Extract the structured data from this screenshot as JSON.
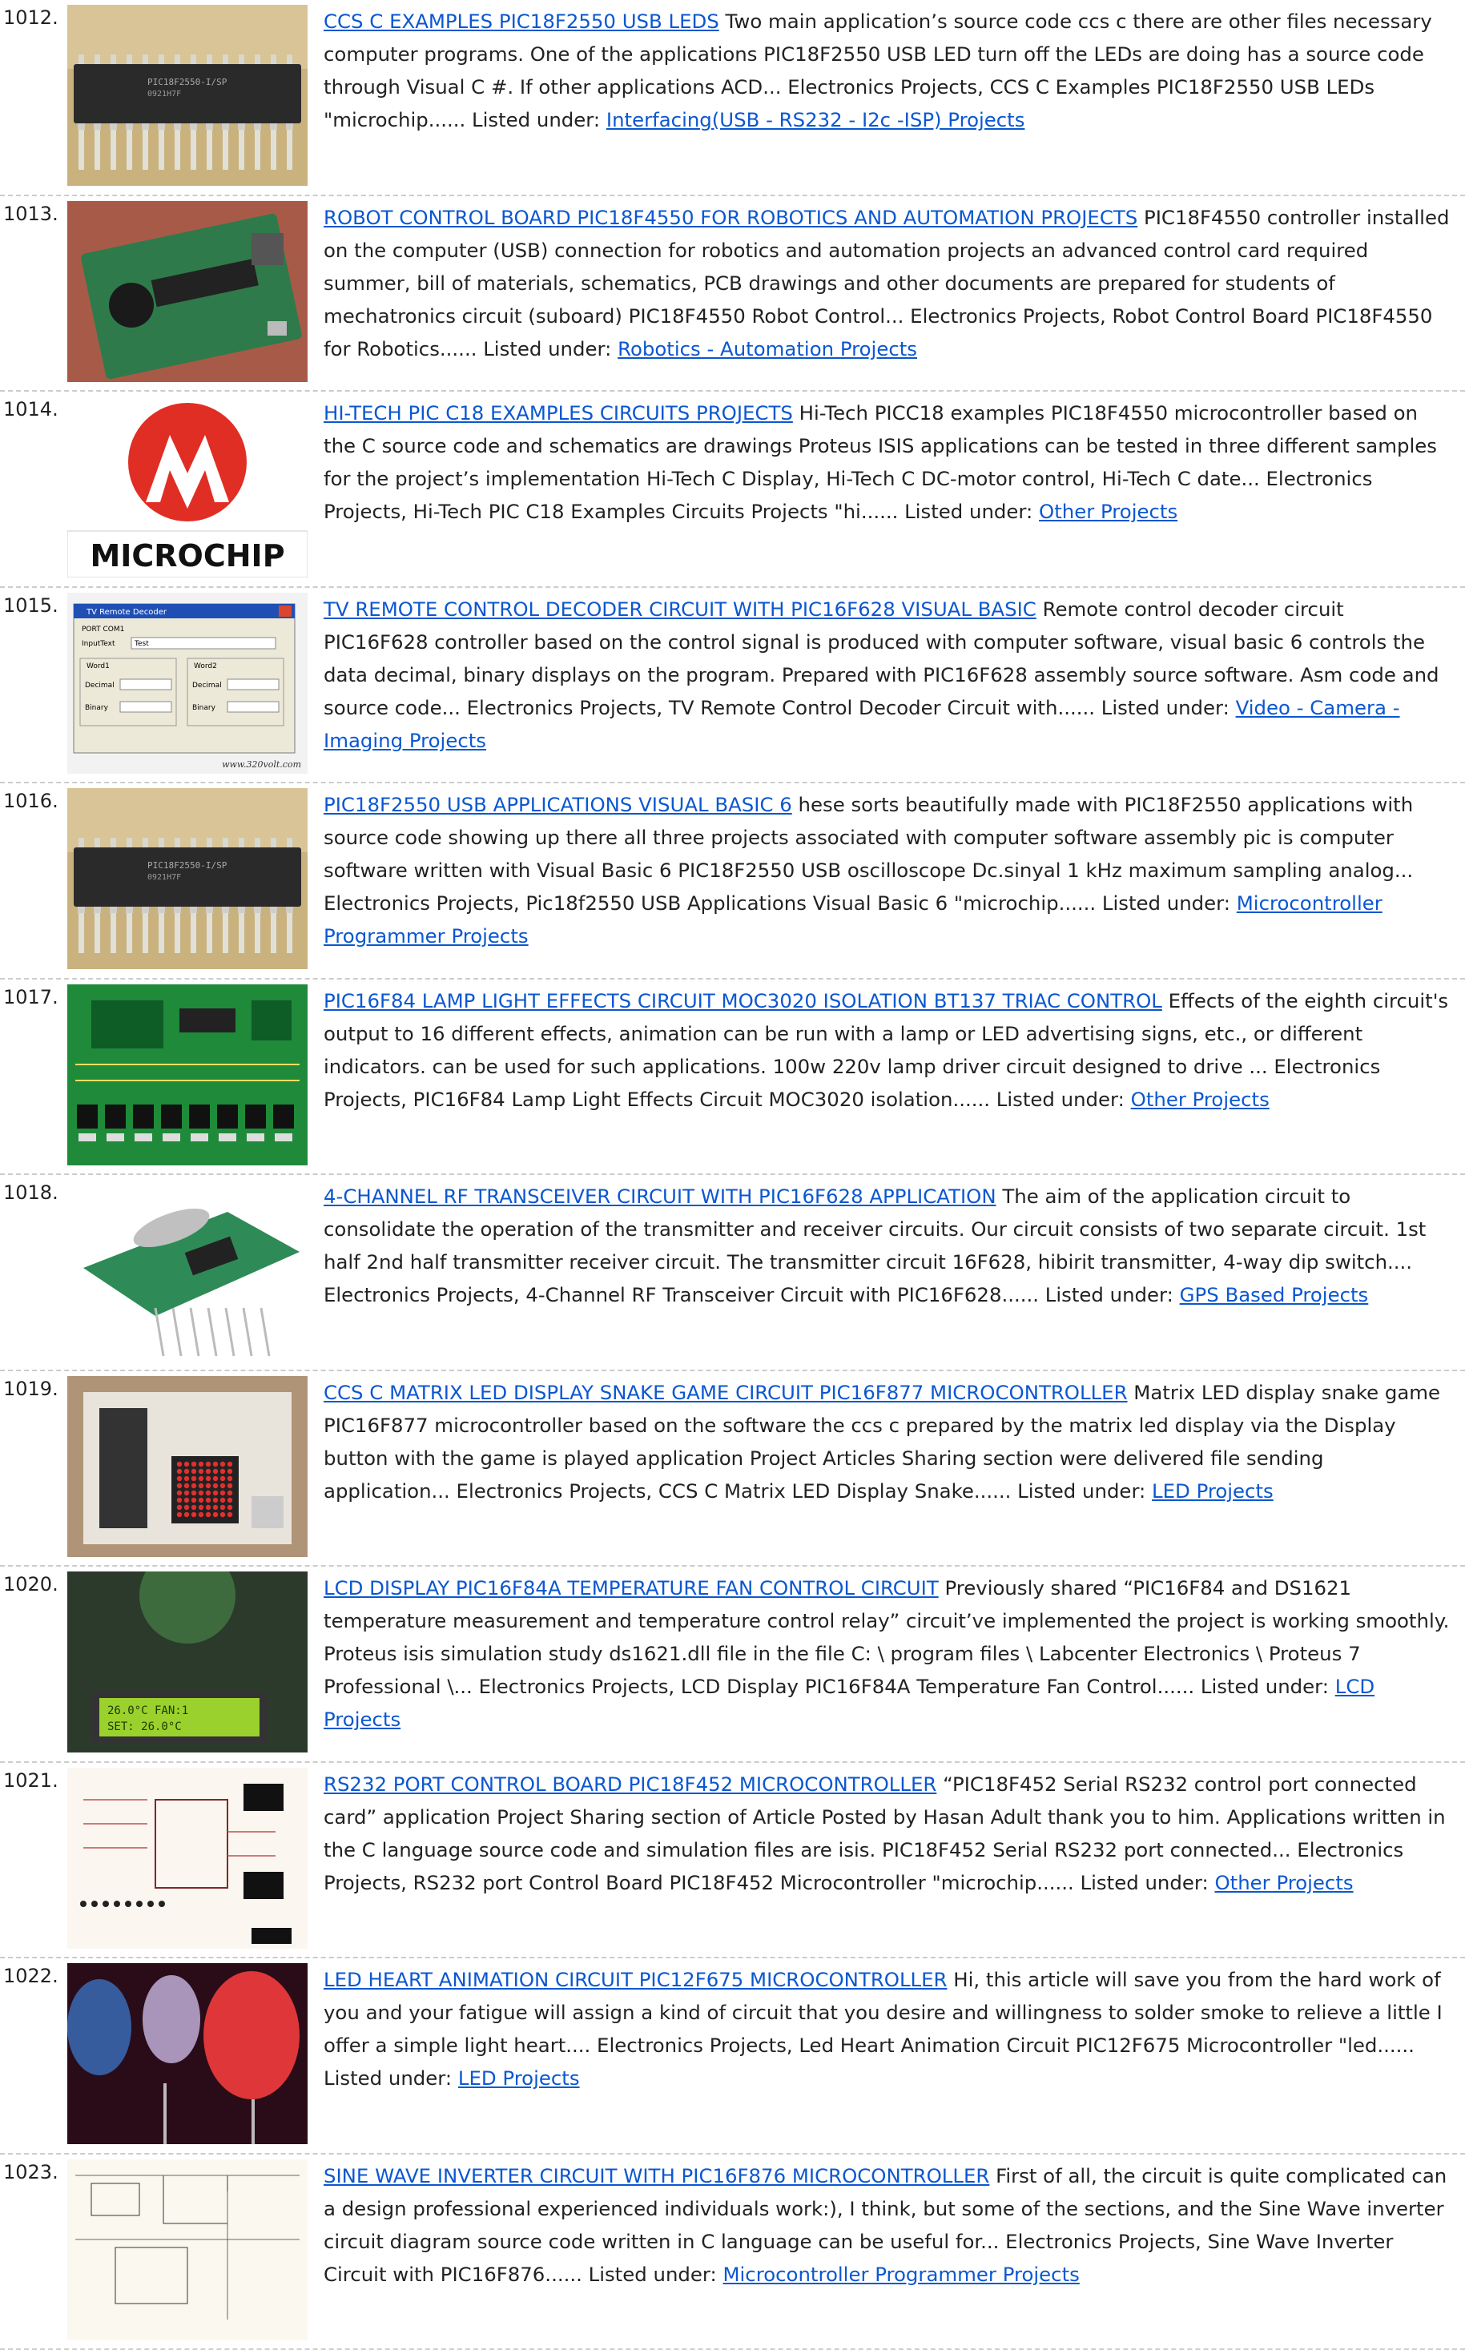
{
  "brand_colors": {
    "link": "#0b57d0",
    "text": "#222222",
    "divider": "#cccccc"
  },
  "listed_under_label": "Listed under:",
  "items": [
    {
      "number": "1012.",
      "thumb": "pic18f2550-dip-chip-photo",
      "title": "CCS C EXAMPLES PIC18F2550 USB LEDS",
      "body": "Two main application’s source code ccs c there are other files necessary computer programs. One of the applications PIC18F2550 USB LED turn off the LEDs are doing has a source code through Visual C #. If other applications ACD... Electronics Projects, CCS C Examples PIC18F2550 USB LEDs \"microchip......",
      "category": "Interfacing(USB - RS232 - I2c -ISP) Projects"
    },
    {
      "number": "1013.",
      "thumb": "robot-control-board-photo",
      "title": "ROBOT CONTROL BOARD PIC18F4550 FOR ROBOTICS AND AUTOMATION PROJECTS",
      "body": "PIC18F4550 controller installed on the computer (USB) connection for robotics and automation projects an advanced control card required summer, bill of materials, schematics, PCB drawings and other documents are prepared for students of mechatronics circuit (suboard) PIC18F4550 Robot Control... Electronics Projects, Robot Control Board PIC18F4550 for Robotics......",
      "category": "Robotics - Automation Projects"
    },
    {
      "number": "1014.",
      "thumb": "microchip-logo",
      "logo_text": "MICROCHIP",
      "title": "HI-TECH PIC C18 EXAMPLES CIRCUITS PROJECTS",
      "body": "Hi-Tech PICC18 examples PIC18F4550 microcontroller based on the C source code and schematics are drawings Proteus ISIS applications can be tested in three different samples for the project’s implementation Hi-Tech C Display, Hi-Tech C DC-motor control, Hi-Tech C date... Electronics Projects, Hi-Tech PIC C18 Examples Circuits Projects \"hi......",
      "category": "Other Projects"
    },
    {
      "number": "1015.",
      "thumb": "tv-remote-decoder-window",
      "win": {
        "title": "TV Remote Decoder",
        "port": "PORT COM1",
        "input_label": "InputText",
        "input_value": "Test",
        "group1": "Word1",
        "group2": "Word2",
        "decimal": "Decimal",
        "binary": "Binary",
        "watermark": "www.320volt.com"
      },
      "title": "TV REMOTE CONTROL DECODER CIRCUIT WITH PIC16F628 VISUAL BASIC",
      "body": "Remote control decoder circuit PIC16F628 controller based on the control signal is produced with computer software, visual basic 6 controls the data decimal, binary displays on the program. Prepared with PIC16F628 assembly source software. Asm code and source code... Electronics Projects, TV Remote Control Decoder Circuit with......",
      "category": "Video - Camera - Imaging Projects"
    },
    {
      "number": "1016.",
      "thumb": "pic18f2550-dip-chip-photo",
      "title": "PIC18F2550 USB APPLICATIONS VISUAL BASIC 6",
      "body": "hese sorts beautifully made with PIC18F2550 applications with source code showing up there all three projects associated with computer software assembly pic is computer software written with Visual Basic 6 PIC18F2550 USB oscilloscope Dc.sinyal 1 kHz maximum sampling analog... Electronics Projects, Pic18f2550 USB Applications Visual Basic 6 \"microchip......",
      "category": "Microcontroller Programmer Projects"
    },
    {
      "number": "1017.",
      "thumb": "green-pcb-layout",
      "title": "PIC16F84 LAMP LIGHT EFFECTS CIRCUIT MOC3020 ISOLATION BT137 TRIAC CONTROL",
      "body": "Effects of the eighth circuit's output to 16 different effects, animation can be run with a lamp or LED advertising signs, etc., or different indicators. can be used for such applications. 100w 220v lamp driver circuit designed to drive ... Electronics Projects, PIC16F84 Lamp Light Effects Circuit MOC3020 isolation......",
      "category": "Other Projects"
    },
    {
      "number": "1018.",
      "thumb": "rf-module-photo",
      "title": "4-CHANNEL RF TRANSCEIVER CIRCUIT WITH PIC16F628 APPLICATION",
      "body": "The aim of the application circuit to consolidate the operation of the transmitter and receiver circuits. Our circuit consists of two separate circuit. 1st half 2nd half transmitter receiver circuit. The transmitter circuit 16F628, hibirit transmitter, 4-way dip switch.... Electronics Projects, 4-Channel RF Transceiver Circuit with PIC16F628......",
      "category": "GPS Based Projects"
    },
    {
      "number": "1019.",
      "thumb": "breadboard-matrix-photo",
      "title": "CCS C MATRIX LED DISPLAY SNAKE GAME CIRCUIT PIC16F877 MICROCONTROLLER",
      "body": "Matrix LED display snake game PIC16F877 microcontroller based on the software the ccs c prepared by the matrix led display via the Display button with the game is played application Project Articles Sharing section were delivered file sending application... Electronics Projects, CCS C Matrix LED Display Snake......",
      "category": "LED Projects"
    },
    {
      "number": "1020.",
      "thumb": "lcd-fan-photo",
      "lcd": {
        "line1": "26.0°C  FAN:1",
        "line2": "SET: 26.0°C"
      },
      "title": "LCD DISPLAY PIC16F84A TEMPERATURE FAN CONTROL CIRCUIT",
      "body": "Previously shared “PIC16F84 and DS1621 temperature measurement and temperature control relay” circuit’ve implemented the project is working smoothly. Proteus isis simulation study ds1621.dll file in the file C: \\ program files \\ Labcenter Electronics \\ Proteus 7 Professional \\... Electronics Projects, LCD Display PIC16F84A Temperature Fan Control......",
      "category": "LCD Projects"
    },
    {
      "number": "1021.",
      "thumb": "isis-schematic",
      "title": "RS232 PORT CONTROL BOARD PIC18F452 MICROCONTROLLER",
      "body": "“PIC18F452 Serial RS232 control port connected card” application Project Sharing section of Article Posted by Hasan Adult thank you to him. Applications written in the C language source code and simulation files are isis. PIC18F452 Serial RS232 port connected... Electronics Projects, RS232 port Control Board PIC18F452 Microcontroller \"microchip......",
      "category": "Other Projects"
    },
    {
      "number": "1022.",
      "thumb": "led-heart-photo",
      "title": "LED HEART ANIMATION CIRCUIT PIC12F675 MICROCONTROLLER",
      "body": "Hi, this article will save you from the hard work of you and your fatigue will assign a kind of circuit that you desire and willingness to solder smoke to relieve a little I offer a simple light heart.... Electronics Projects, Led Heart Animation Circuit PIC12F675 Microcontroller \"led......",
      "category": "LED Projects"
    },
    {
      "number": "1023.",
      "thumb": "inverter-schematic",
      "title": "SINE WAVE INVERTER CIRCUIT WITH PIC16F876 MICROCONTROLLER",
      "body": "First of all, the circuit is quite complicated can a design professional experienced individuals work:), I think, but some of the sections, and the Sine Wave inverter circuit diagram source code written in C language can be useful for... Electronics Projects, Sine Wave Inverter Circuit with PIC16F876......",
      "category": "Microcontroller Programmer Projects"
    }
  ]
}
